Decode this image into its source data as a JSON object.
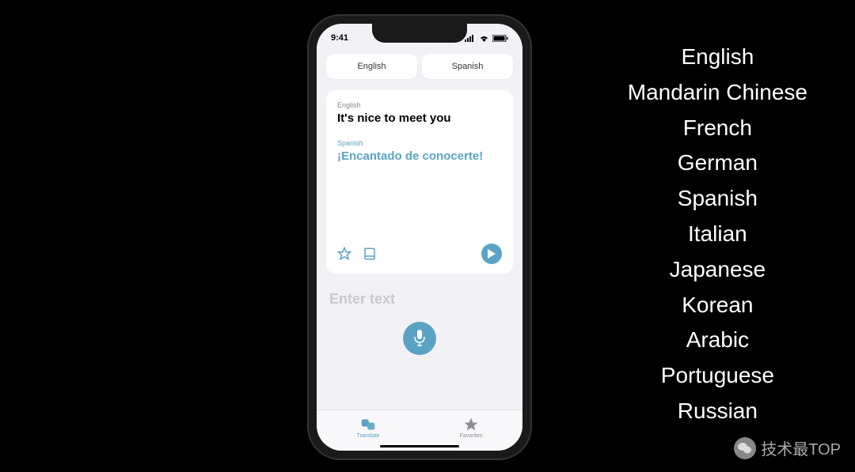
{
  "status_bar": {
    "time": "9:41"
  },
  "language_tabs": {
    "source": "English",
    "target": "Spanish"
  },
  "translation": {
    "source_label": "English",
    "source_text": "It's nice to meet you",
    "target_label": "Spanish",
    "target_text": "¡Encantado de conocerte!"
  },
  "input": {
    "placeholder": "Enter text"
  },
  "tab_bar": {
    "translate": "Translate",
    "favorites": "Favorites"
  },
  "language_list": [
    "English",
    "Mandarin Chinese",
    "French",
    "German",
    "Spanish",
    "Italian",
    "Japanese",
    "Korean",
    "Arabic",
    "Portuguese",
    "Russian"
  ],
  "watermark": "技术最TOP",
  "colors": {
    "accent": "#5ba3c4",
    "background": "#f2f2f6"
  }
}
